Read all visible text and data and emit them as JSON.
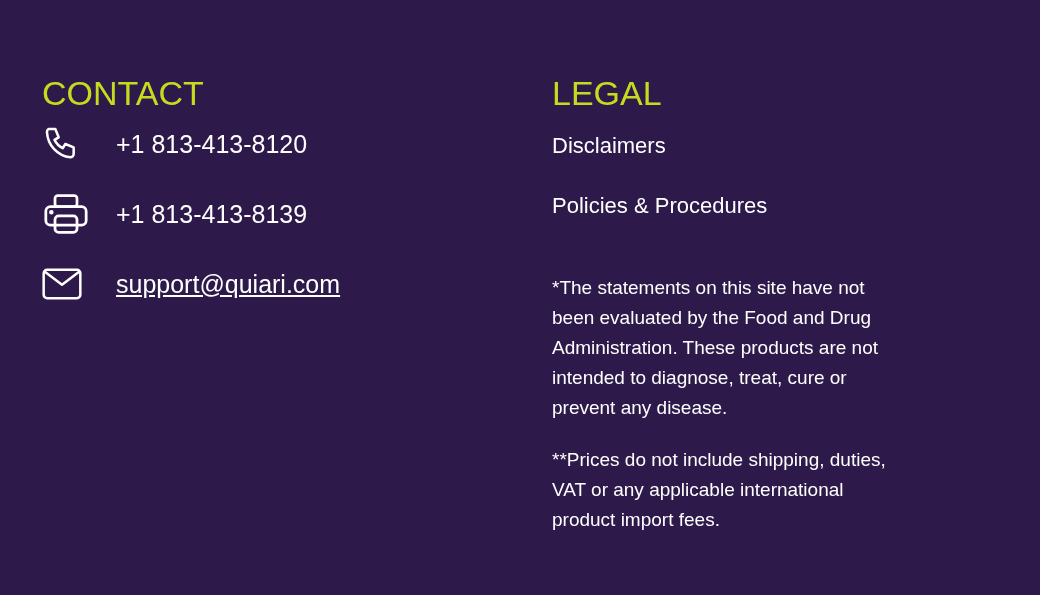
{
  "contact": {
    "heading": "CONTACT",
    "items": [
      {
        "kind": "phone",
        "text": "+1 813-413-8120"
      },
      {
        "kind": "fax",
        "text": "+1 813-413-8139"
      },
      {
        "kind": "email",
        "text": "support@quiari.com"
      }
    ]
  },
  "legal": {
    "heading": "LEGAL",
    "links": [
      "Disclaimers",
      "Policies & Procedures"
    ],
    "notes": [
      "*The statements on this site have not been evaluated by the Food and Drug Administration. These products are not intended to diagnose, treat, cure or prevent any disease.",
      "**Prices do not include shipping, duties, VAT or any applicable international product import fees."
    ]
  }
}
